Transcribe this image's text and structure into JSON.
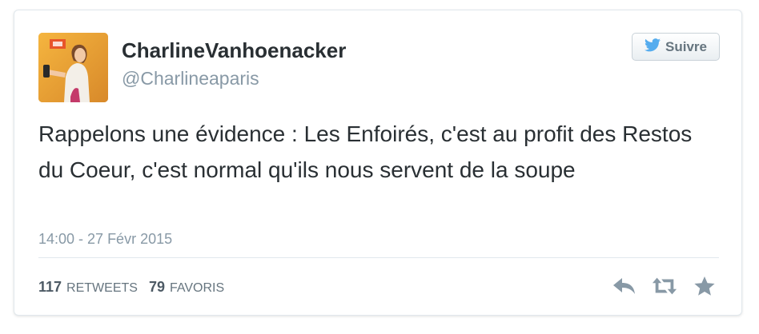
{
  "tweet": {
    "display_name": "CharlineVanhoenacker",
    "handle": "@Charlineaparis",
    "follow_label": "Suivre",
    "text": "Rappelons une évidence : Les Enfoirés, c'est au profit des Restos du Coeur, c'est normal qu'ils nous servent de la soupe",
    "timestamp": "14:00 - 27 Févr 2015",
    "retweets_count": "117",
    "retweets_label": "RETWEETS",
    "favorites_count": "79",
    "favorites_label": "FAVORIS"
  },
  "icons": {
    "follow": "twitter-bird-icon",
    "reply": "reply-icon",
    "retweet": "retweet-icon",
    "favorite": "star-icon"
  },
  "colors": {
    "twitter_blue": "#55acee",
    "text": "#292f33",
    "muted": "#8899a6",
    "icon_gray": "#8899a6"
  }
}
